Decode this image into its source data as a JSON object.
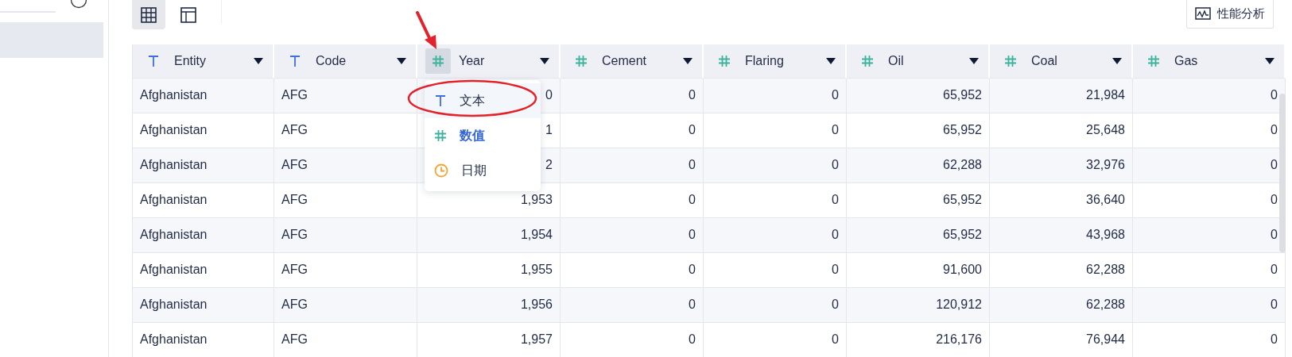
{
  "sidebar": {
    "items": [
      {
        "selected": true
      }
    ]
  },
  "toolbar": {
    "views": [
      {
        "kind": "grid",
        "selected": true
      },
      {
        "kind": "layout",
        "selected": false
      }
    ],
    "perf_button": "性能分析"
  },
  "table": {
    "columns": [
      {
        "label": "Entity",
        "kind": "text",
        "menu_open": false
      },
      {
        "label": "Code",
        "kind": "text",
        "menu_open": false
      },
      {
        "label": "Year",
        "kind": "number",
        "menu_open": true
      },
      {
        "label": "Cement",
        "kind": "number",
        "menu_open": false
      },
      {
        "label": "Flaring",
        "kind": "number",
        "menu_open": false
      },
      {
        "label": "Oil",
        "kind": "number",
        "menu_open": false
      },
      {
        "label": "Coal",
        "kind": "number",
        "menu_open": false
      },
      {
        "label": "Gas",
        "kind": "number",
        "menu_open": false
      }
    ],
    "rows": [
      [
        "Afghanistan",
        "AFG",
        "0",
        "0",
        "0",
        "65,952",
        "21,984",
        "0"
      ],
      [
        "Afghanistan",
        "AFG",
        "1",
        "0",
        "0",
        "65,952",
        "25,648",
        "0"
      ],
      [
        "Afghanistan",
        "AFG",
        "2",
        "0",
        "0",
        "62,288",
        "32,976",
        "0"
      ],
      [
        "Afghanistan",
        "AFG",
        "1,953",
        "0",
        "0",
        "65,952",
        "36,640",
        "0"
      ],
      [
        "Afghanistan",
        "AFG",
        "1,954",
        "0",
        "0",
        "65,952",
        "43,968",
        "0"
      ],
      [
        "Afghanistan",
        "AFG",
        "1,955",
        "0",
        "0",
        "91,600",
        "62,288",
        "0"
      ],
      [
        "Afghanistan",
        "AFG",
        "1,956",
        "0",
        "0",
        "120,912",
        "62,288",
        "0"
      ],
      [
        "Afghanistan",
        "AFG",
        "1,957",
        "0",
        "0",
        "216,176",
        "76,944",
        "0"
      ]
    ]
  },
  "type_menu": {
    "items": [
      {
        "label": "文本",
        "kind": "text",
        "selected": false,
        "hovered": true
      },
      {
        "label": "数值",
        "kind": "number",
        "selected": true,
        "hovered": false
      },
      {
        "label": "日期",
        "kind": "date",
        "selected": false,
        "hovered": false
      }
    ]
  }
}
